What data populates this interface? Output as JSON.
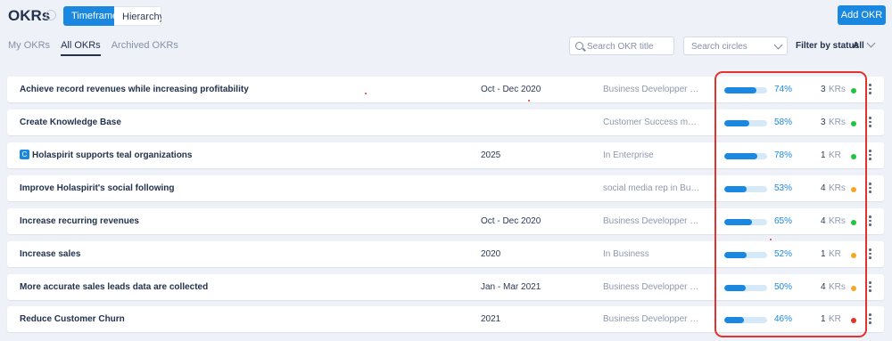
{
  "header": {
    "title": "OKRs",
    "view_tabs": [
      "Timeframe",
      "Hierarchy"
    ],
    "add_button": "Add OKR"
  },
  "tabs": [
    "My OKRs",
    "All OKRs",
    "Archived OKRs"
  ],
  "search": {
    "placeholder": "Search OKR title"
  },
  "circles_select": {
    "placeholder": "Search circles"
  },
  "filter": {
    "label": "Filter by status",
    "value": "All"
  },
  "colors": {
    "accent": "#1a88e1",
    "green": "#22c43e",
    "orange": "#f5a623",
    "red": "#e0342c"
  },
  "okrs": [
    {
      "title": "Achieve record revenues while increasing profitability",
      "timeframe": "Oct - Dec 2020",
      "circle": "Business Developper Internati...",
      "progress": 74,
      "progress_label": "74%",
      "kr_count": "3",
      "kr_label": "KRs",
      "status": "green"
    },
    {
      "title": "Create Knowledge Base",
      "timeframe": "",
      "circle": "Customer Success manager in ...",
      "progress": 58,
      "progress_label": "58%",
      "kr_count": "3",
      "kr_label": "KRs",
      "status": "green"
    },
    {
      "title": "Holaspirit supports teal organizations",
      "badge": "C",
      "timeframe": "2025",
      "circle": "In Enterprise",
      "progress": 78,
      "progress_label": "78%",
      "kr_count": "1",
      "kr_label": "KR",
      "status": "green"
    },
    {
      "title": "Improve Holaspirit's social following",
      "timeframe": "",
      "circle": "social media rep in Business",
      "progress": 53,
      "progress_label": "53%",
      "kr_count": "4",
      "kr_label": "KRs",
      "status": "orange"
    },
    {
      "title": "Increase recurring revenues",
      "timeframe": "Oct - Dec 2020",
      "circle": "Business Developper Internati...",
      "progress": 65,
      "progress_label": "65%",
      "kr_count": "4",
      "kr_label": "KRs",
      "status": "green"
    },
    {
      "title": "Increase sales",
      "timeframe": "2020",
      "circle": "In Business",
      "progress": 52,
      "progress_label": "52%",
      "kr_count": "1",
      "kr_label": "KR",
      "status": "orange"
    },
    {
      "title": "More accurate sales leads data are collected",
      "timeframe": "Jan - Mar 2021",
      "circle": "Business Developper Internati...",
      "progress": 50,
      "progress_label": "50%",
      "kr_count": "4",
      "kr_label": "KRs",
      "status": "orange"
    },
    {
      "title": "Reduce Customer Churn",
      "timeframe": "2021",
      "circle": "Business Developper Internati...",
      "progress": 46,
      "progress_label": "46%",
      "kr_count": "1",
      "kr_label": "KR",
      "status": "red"
    }
  ]
}
